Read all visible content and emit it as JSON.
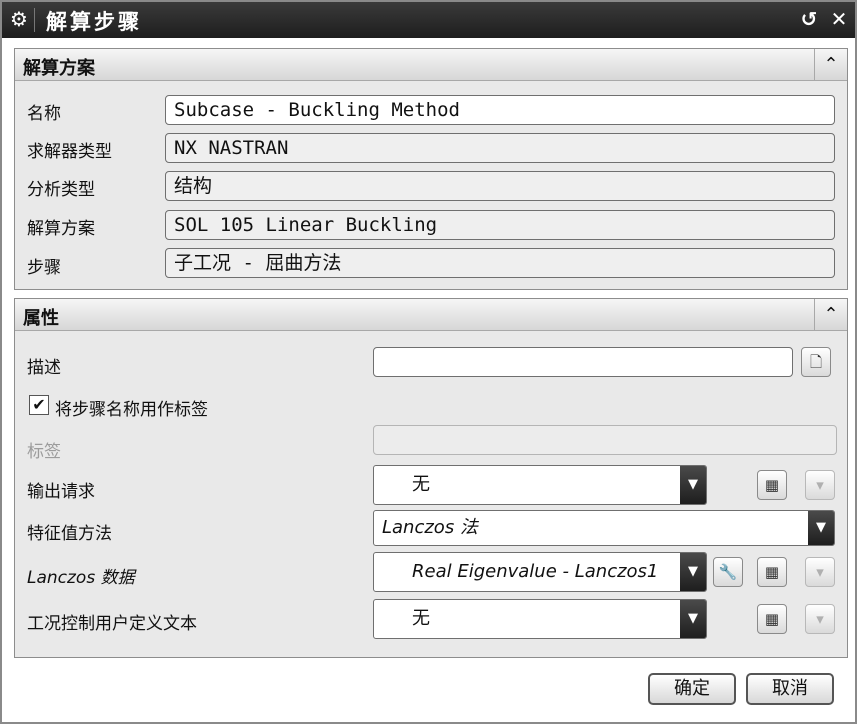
{
  "window": {
    "title": "解算步骤",
    "icon": "gear-icon"
  },
  "solution_group": {
    "title": "解算方案",
    "fields": [
      {
        "label": "名称",
        "value": "Subcase - Buckling Method"
      },
      {
        "label": "求解器类型",
        "value": "NX NASTRAN"
      },
      {
        "label": "分析类型",
        "value": "结构"
      },
      {
        "label": "解算方案",
        "value": "SOL 105 Linear Buckling"
      },
      {
        "label": "步骤",
        "value": "子工况 - 屈曲方法"
      }
    ]
  },
  "properties_group": {
    "title": "属性",
    "description_label": "描述",
    "description_value": "",
    "checkbox_label": "将步骤名称用作标签",
    "checkbox_checked": true,
    "tag_label": "标签",
    "output_request": {
      "label": "输出请求",
      "value": "无"
    },
    "eigen_method": {
      "label": "特征值方法",
      "value": "Lanczos 法"
    },
    "lanczos_data": {
      "label": "Lanczos 数据",
      "value": "Real Eigenvalue - Lanczos1"
    },
    "case_control": {
      "label": "工况控制用户定义文本",
      "value": "无"
    }
  },
  "buttons": {
    "ok": "确定",
    "cancel": "取消"
  }
}
